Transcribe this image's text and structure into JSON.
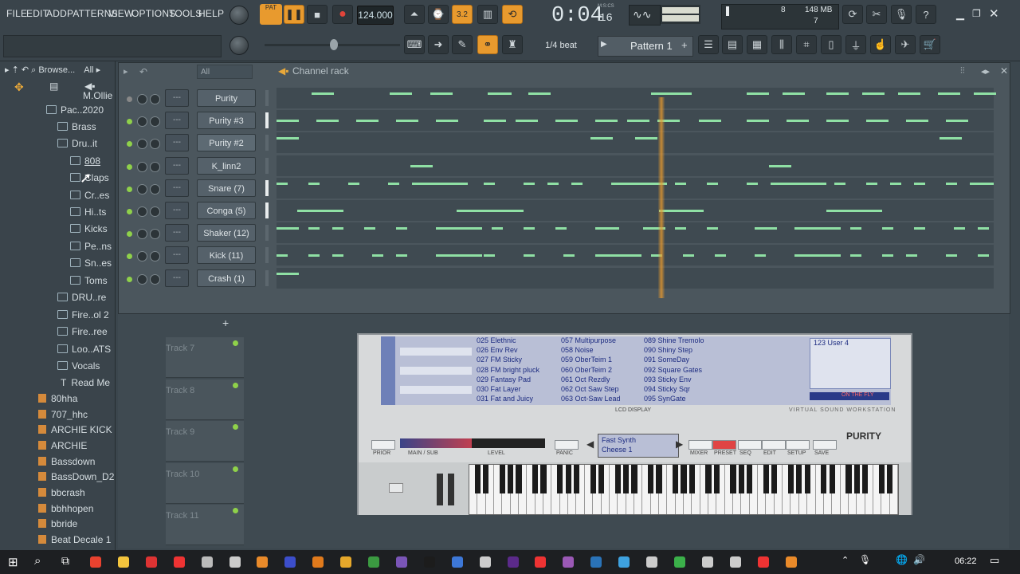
{
  "menu": [
    "FILE",
    "EDIT",
    "ADD",
    "PATTERNS",
    "VIEW",
    "OPTIONS",
    "TOOLS",
    "HELP"
  ],
  "transport": {
    "pat_label": "PAT",
    "tempo": "124.000",
    "time": "0:04",
    "time_small": "16",
    "time_format": "M:S:CS",
    "snap": "1/4 beat",
    "pattern": "Pattern 1",
    "cpu_mem": "148 MB",
    "cpu_voices": "7",
    "cpu_num": "8",
    "plus_sign": "+"
  },
  "browser": {
    "header": "Browse...",
    "filter": "All",
    "tree": [
      {
        "label": "M.Ollie"
      },
      {
        "label": "Pac..2020"
      },
      {
        "label": "Brass"
      },
      {
        "label": "Dru..it"
      },
      {
        "label": "808"
      },
      {
        "label": "Claps"
      },
      {
        "label": "Cr..es"
      },
      {
        "label": "Hi..ts"
      },
      {
        "label": "Kicks"
      },
      {
        "label": "Pe..ns"
      },
      {
        "label": "Sn..es"
      },
      {
        "label": "Toms"
      },
      {
        "label": "DRU..re"
      },
      {
        "label": "Fire..ol 2"
      },
      {
        "label": "Fire..ree"
      },
      {
        "label": "Loo..ATS"
      },
      {
        "label": "Vocals"
      },
      {
        "label": "Read Me"
      },
      {
        "label": "80hha"
      },
      {
        "label": "707_hhc"
      },
      {
        "label": "ARCHIE  KICK"
      },
      {
        "label": "ARCHIE"
      },
      {
        "label": "Bassdown"
      },
      {
        "label": "BassDown_D2"
      },
      {
        "label": "bbcrash"
      },
      {
        "label": "bbhhopen"
      },
      {
        "label": "bbride"
      },
      {
        "label": "Beat Decale 1"
      }
    ]
  },
  "rack": {
    "title": "Channel rack",
    "filter": "All",
    "add_label": "+",
    "dash": "---",
    "channels": [
      "Purity",
      "Purity #3",
      "Purity #2",
      "K_linn2",
      "Snare (7)",
      "Conga (5)",
      "Shaker (12)",
      "Kick (11)",
      "Crash (1)"
    ]
  },
  "playlist": {
    "tracks": [
      "Track 7",
      "Track 8",
      "Track 9",
      "Track 10",
      "Track 11"
    ]
  },
  "plugin": {
    "name": "PURITY",
    "lcd_label": "LCD DISPLAY",
    "footer": "VIRTUAL   SOUND   WORKSTATION",
    "col1": [
      "025 Elethnic",
      "026 Env Rev",
      "027 FM Sticky",
      "028 FM bright pluck",
      "029 Fantasy Pad",
      "030 Fat  Layer",
      "031 Fat and Juicy"
    ],
    "col2": [
      "057 Multipurpose",
      "058 Noise",
      "059 OberTeim 1",
      "060 OberTeim 2",
      "061 Oct Rezdly",
      "062 Oct Saw Step",
      "063 Oct-Saw Lead"
    ],
    "col3": [
      "089 Shine Tremolo",
      "090 Shiny Step",
      "091 SomeDay",
      "092 Square Gates",
      "093 Sticky Env",
      "094 Sticky Sqr",
      "095 SynGate"
    ],
    "user": "123 User 4",
    "on_fly": "ON THE FLY",
    "patch_top": "Fast Synth",
    "patch_bottom": "Cheese 1",
    "buttons": [
      "PRIOR",
      "MAIN / SUB",
      "LEVEL",
      "PANIC",
      "MIXER",
      "PRESET",
      "SEQ",
      "EDIT",
      "SETUP",
      "SAVE"
    ]
  },
  "taskbar": {
    "clock": "06:22"
  }
}
